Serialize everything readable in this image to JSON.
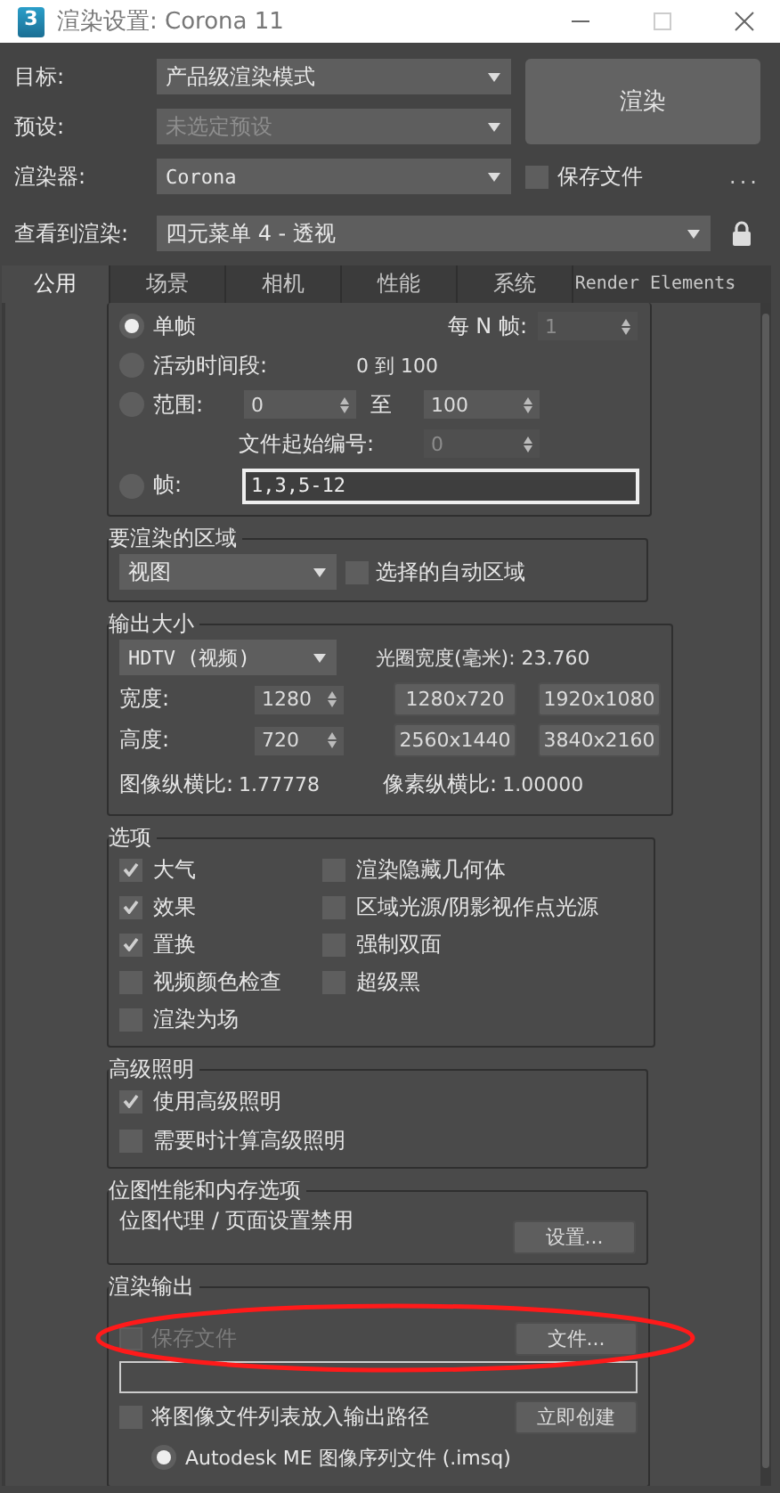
{
  "window": {
    "logo": "3",
    "title": "渲染设置: Corona 11"
  },
  "header": {
    "target": {
      "label": "目标:",
      "value": "产品级渲染模式"
    },
    "preset": {
      "label": "预设:",
      "value": "未选定预设",
      "disabled": true
    },
    "renderer": {
      "label": "渲染器:",
      "value": "Corona"
    },
    "render_button": "渲染",
    "save_file": {
      "label": "保存文件",
      "checked": false
    },
    "more": "...",
    "view": {
      "label": "查看到渲染:",
      "value": "四元菜单 4 - 透视"
    }
  },
  "tabs": [
    {
      "label": "公用",
      "selected": true
    },
    {
      "label": "场景",
      "selected": false
    },
    {
      "label": "相机",
      "selected": false
    },
    {
      "label": "性能",
      "selected": false
    },
    {
      "label": "系统",
      "selected": false
    },
    {
      "label": "Render Elements",
      "selected": false
    }
  ],
  "time_output": {
    "every_n": {
      "label": "每 N 帧:",
      "value": "1",
      "disabled": true
    },
    "single": {
      "label": "单帧",
      "selected": true
    },
    "active": {
      "label": "活动时间段:",
      "range": "0 到 100",
      "selected": false
    },
    "range": {
      "label": "范围:",
      "from": "0",
      "to_label": "至",
      "to": "100",
      "selected": false
    },
    "file_start": {
      "label": "文件起始编号:",
      "value": "0",
      "disabled": true
    },
    "frames": {
      "label": "帧:",
      "value": "1,3,5-12",
      "selected": false
    }
  },
  "area": {
    "title": "要渲染的区域",
    "dropdown": "视图",
    "auto_region": {
      "label": "选择的自动区域",
      "checked": false
    }
  },
  "output_size": {
    "title": "输出大小",
    "preset": "HDTV (视频)",
    "aperture": "光圈宽度(毫米): 23.760",
    "width": {
      "label": "宽度:",
      "value": "1280"
    },
    "height": {
      "label": "高度:",
      "value": "720"
    },
    "presets": [
      "1280x720",
      "1920x1080",
      "2560x1440",
      "3840x2160"
    ],
    "image_aspect": {
      "label": "图像纵横比:",
      "value": "1.77778"
    },
    "pixel_aspect": {
      "label": "像素纵横比:",
      "value": "1.00000"
    }
  },
  "options": {
    "title": "选项",
    "left": [
      {
        "label": "大气",
        "checked": true
      },
      {
        "label": "效果",
        "checked": true
      },
      {
        "label": "置换",
        "checked": true
      },
      {
        "label": "视频颜色检查",
        "checked": false
      },
      {
        "label": "渲染为场",
        "checked": false
      }
    ],
    "right": [
      {
        "label": "渲染隐藏几何体",
        "checked": false
      },
      {
        "label": "区域光源/阴影视作点光源",
        "checked": false
      },
      {
        "label": "强制双面",
        "checked": false
      },
      {
        "label": "超级黑",
        "checked": false
      }
    ]
  },
  "advanced_lighting": {
    "title": "高级照明",
    "items": [
      {
        "label": "使用高级照明",
        "checked": true
      },
      {
        "label": "需要时计算高级照明",
        "checked": false
      }
    ]
  },
  "bitmap": {
    "title": "位图性能和内存选项",
    "text": "位图代理 / 页面设置禁用",
    "button": "设置..."
  },
  "render_output": {
    "title": "渲染输出",
    "save_file": {
      "label": "保存文件",
      "checked": false,
      "disabled": true
    },
    "files_button": "文件...",
    "image_list": {
      "label": "将图像文件列表放入输出路径",
      "checked": false
    },
    "create_button": "立即创建",
    "formats": [
      {
        "label": "Autodesk ME 图像序列文件 (.imsq)",
        "selected": true
      }
    ]
  }
}
